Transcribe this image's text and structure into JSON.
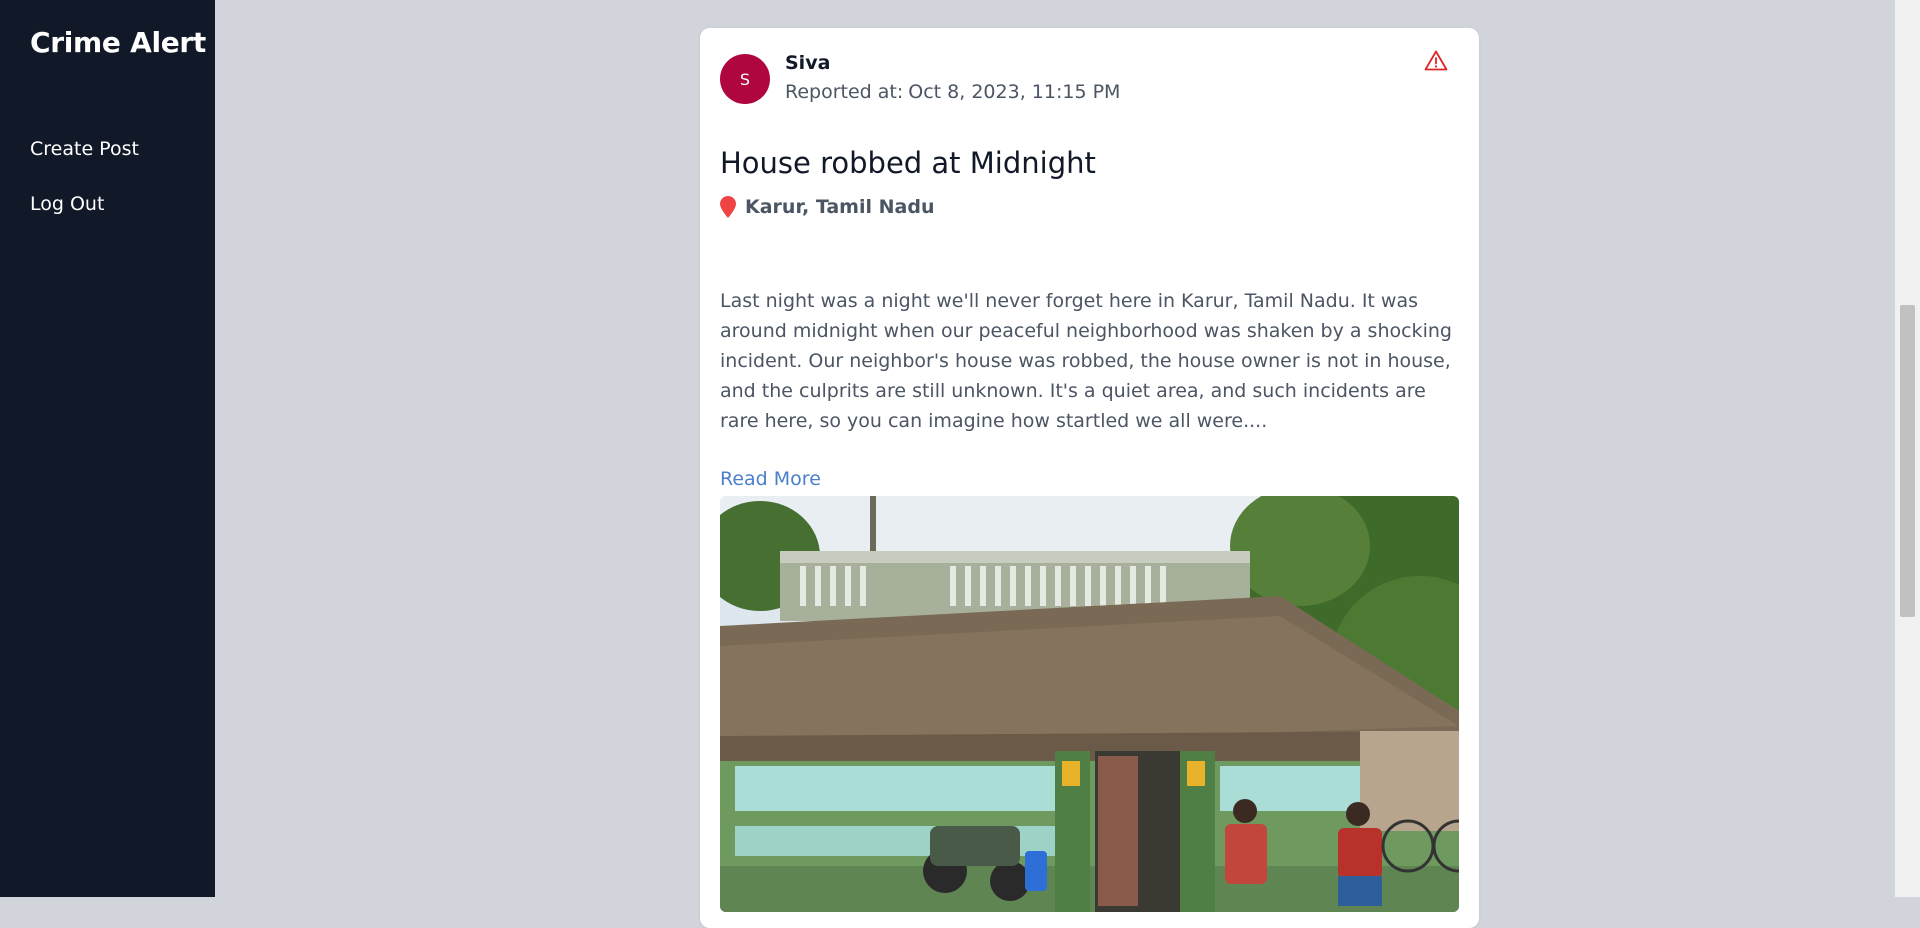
{
  "app": {
    "brand": "Crime Alert"
  },
  "sidebar": {
    "items": [
      {
        "label": "Create Post"
      },
      {
        "label": "Log Out"
      }
    ]
  },
  "post": {
    "avatar_initial": "S",
    "author": "Siva",
    "reported_label": "Reported at:",
    "reported_time": "Oct 8, 2023, 11:15 PM",
    "title": "House robbed at Midnight",
    "location": "Karur, Tamil Nadu",
    "description": "Last night was a night we'll never forget here in Karur, Tamil Nadu. It was around midnight when our peaceful neighborhood was shaken by a shocking incident. Our neighbor's house was robbed, the house owner is not in house, and the culprits are still unknown. It's a quiet area, and such incidents are rare here, so you can imagine how startled we all were....",
    "read_more": "Read More"
  },
  "colors": {
    "sidebar_bg": "#111827",
    "page_bg": "#d1d5db",
    "avatar_bg": "#b0063f",
    "link": "#4a7fcb",
    "alert": "#dc2626",
    "pin": "#ef4444"
  },
  "icons": {
    "alert": "warning-triangle-icon",
    "location": "map-pin-icon"
  }
}
